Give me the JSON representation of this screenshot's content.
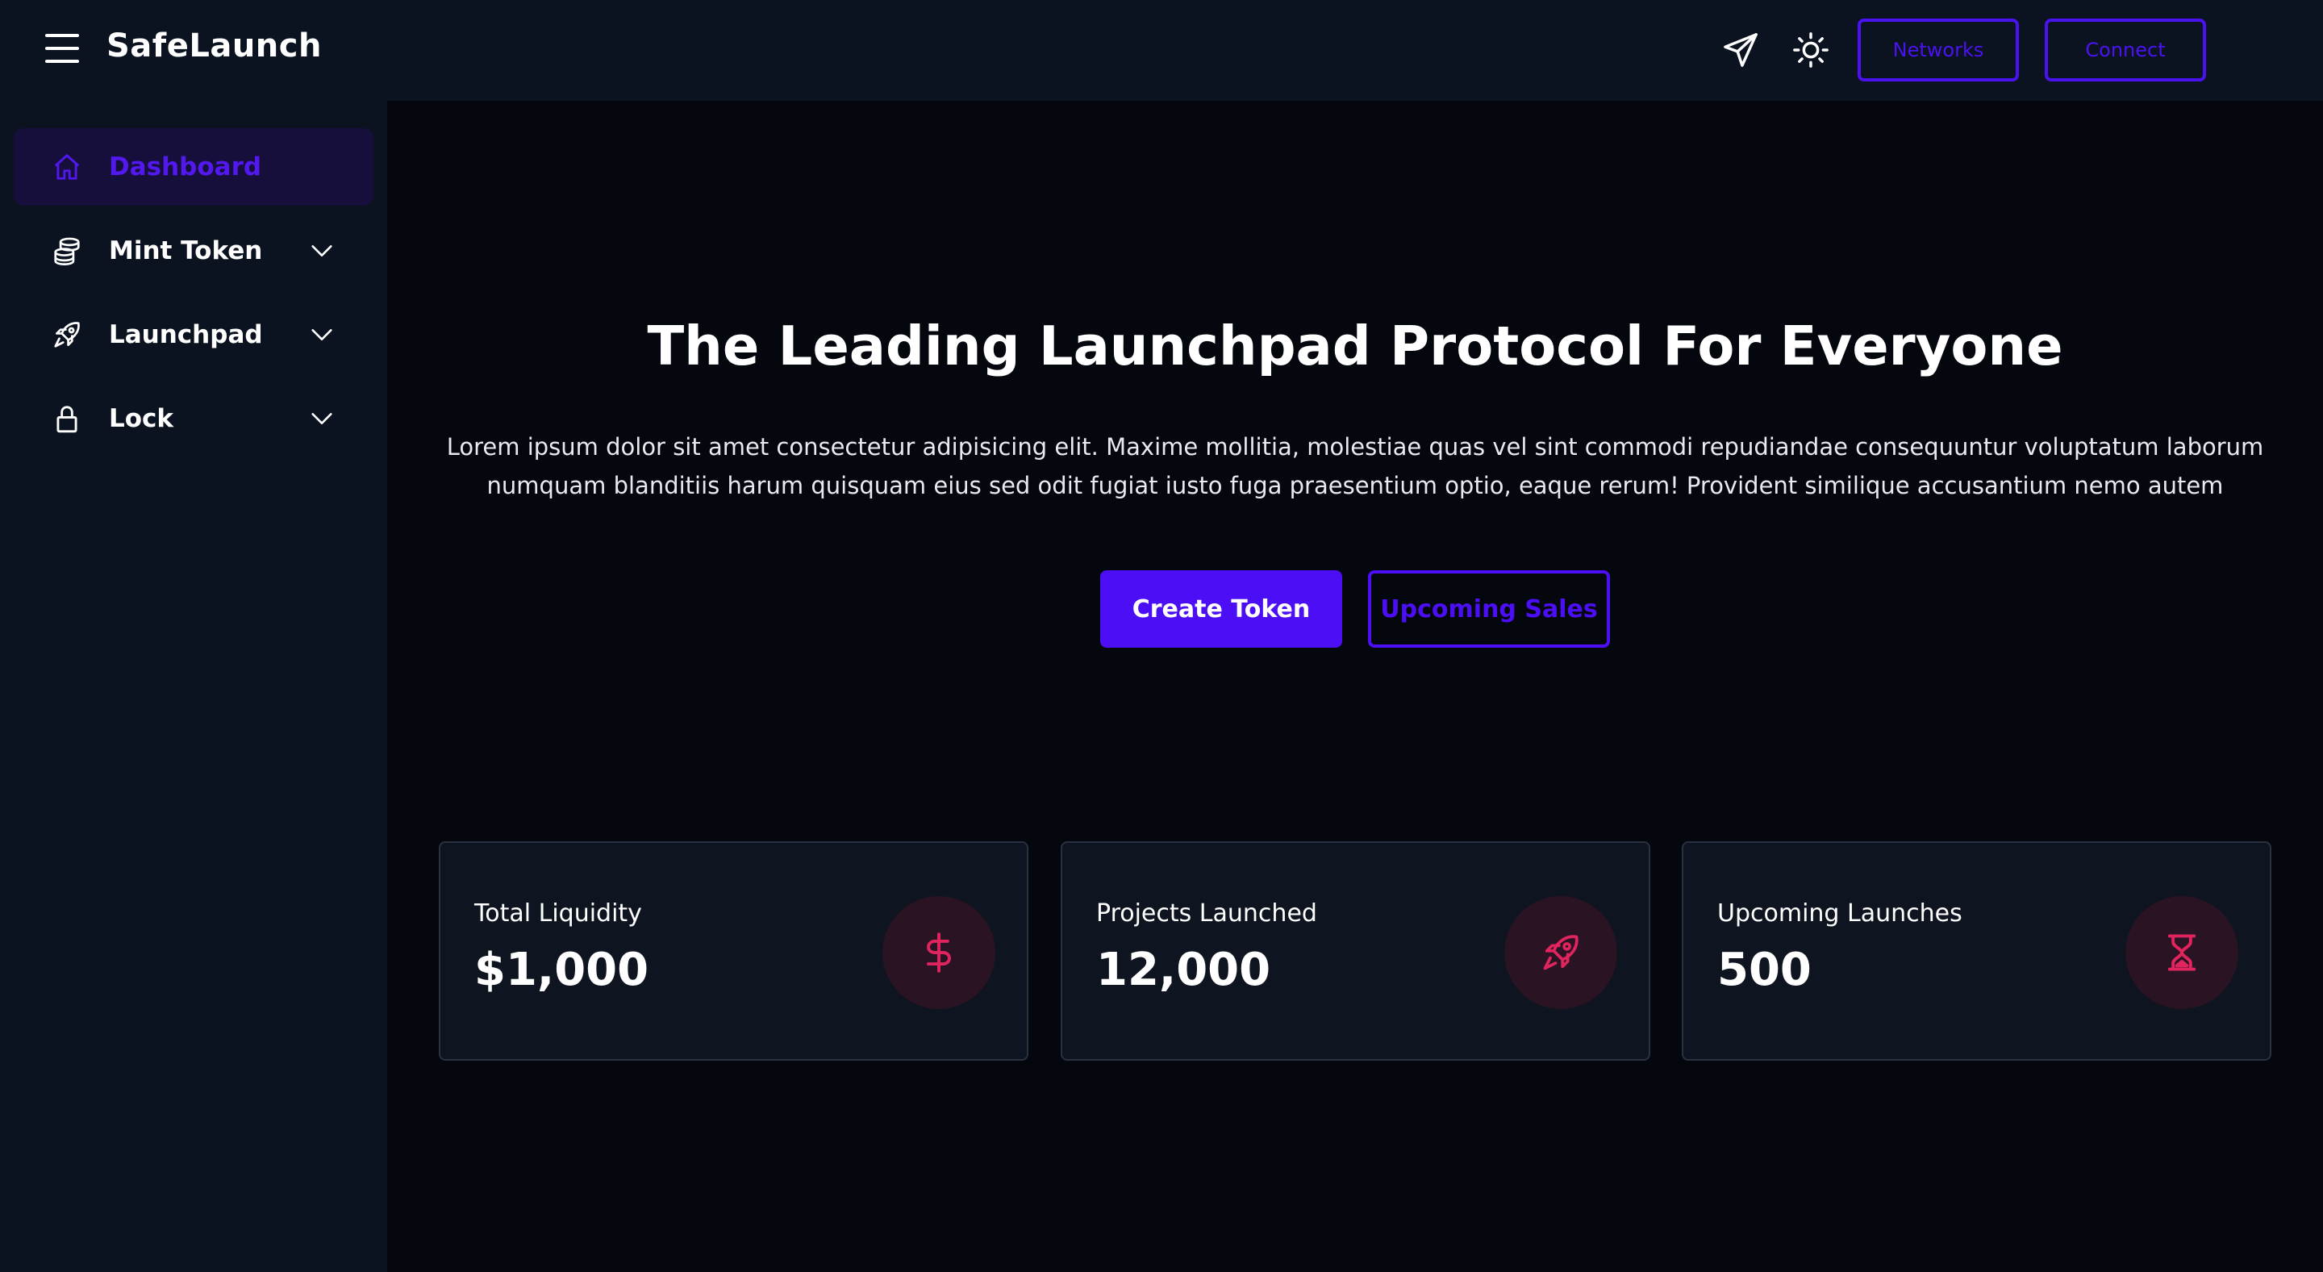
{
  "header": {
    "brand": "SafeLaunch",
    "networks_label": "Networks",
    "connect_label": "Connect"
  },
  "sidebar": {
    "items": [
      {
        "label": "Dashboard",
        "icon": "home-icon",
        "active": true
      },
      {
        "label": "Mint Token",
        "icon": "coins-icon",
        "expandable": true
      },
      {
        "label": "Launchpad",
        "icon": "rocket-icon",
        "expandable": true
      },
      {
        "label": "Lock",
        "icon": "lock-icon",
        "expandable": true
      }
    ]
  },
  "hero": {
    "title": "The Leading Launchpad Protocol For Everyone",
    "description": "Lorem ipsum dolor sit amet consectetur adipisicing elit. Maxime mollitia, molestiae quas vel sint commodi repudiandae consequuntur voluptatum laborum numquam blanditiis harum quisquam eius sed odit fugiat iusto fuga praesentium optio, eaque rerum! Provident similique accusantium nemo autem",
    "create_token_label": "Create Token",
    "upcoming_sales_label": "Upcoming Sales"
  },
  "stats": [
    {
      "label": "Total Liquidity",
      "value": "$1,000",
      "icon": "dollar-icon"
    },
    {
      "label": "Projects Launched",
      "value": "12,000",
      "icon": "rocket-icon"
    },
    {
      "label": "Upcoming Launches",
      "value": "500",
      "icon": "hourglass-icon"
    }
  ],
  "colors": {
    "accent": "#4c0ff5",
    "icon_accent": "#e0245e",
    "panel": "#0c1320",
    "background": "#04070d"
  }
}
